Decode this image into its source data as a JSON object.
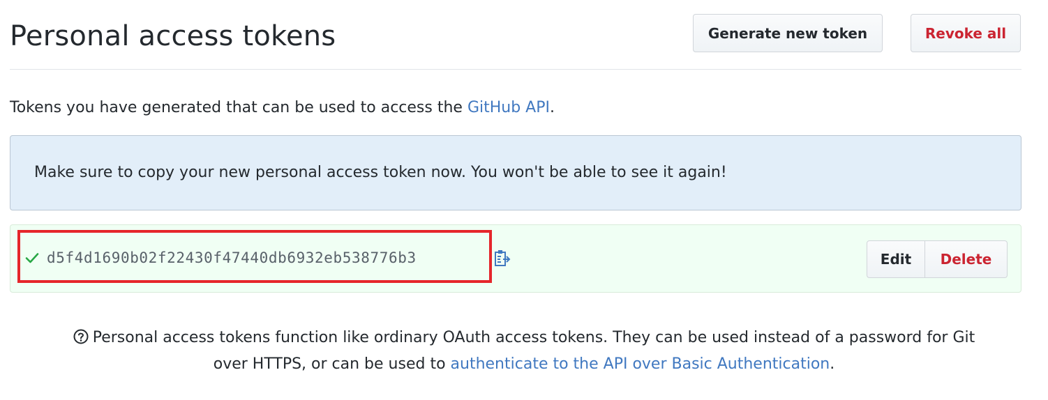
{
  "header": {
    "title": "Personal access tokens",
    "generate_label": "Generate new token",
    "revoke_label": "Revoke all"
  },
  "description": {
    "text": "Tokens you have generated that can be used to access the ",
    "link": "GitHub API",
    "suffix": "."
  },
  "flash": {
    "message": "Make sure to copy your new personal access token now. You won't be able to see it again!"
  },
  "token": {
    "value": "d5f4d1690b02f22430f47440db6932eb538776b3",
    "status_icon": "check-icon",
    "copy_icon": "clipboard-icon",
    "edit_label": "Edit",
    "delete_label": "Delete"
  },
  "note": {
    "line1": "Personal access tokens function like ordinary OAuth access tokens. They can be used instead of a password for Git",
    "line2_prefix": "over HTTPS, or can be used to ",
    "line2_link": "authenticate to the API over Basic Authentication",
    "line2_suffix": ".",
    "icon": "question-icon"
  },
  "colors": {
    "link": "#4078c0",
    "danger": "#cb2431",
    "success": "#28a745",
    "flash_bg": "#e2eef9",
    "token_bg": "#f0fff4",
    "highlight": "#e5262b"
  }
}
